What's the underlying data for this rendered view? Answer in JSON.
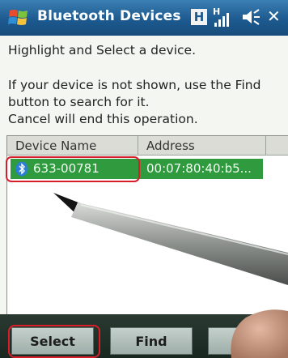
{
  "titlebar": {
    "title": "Bluetooth Devices",
    "status_h": "H",
    "icons": [
      "windows-start-icon",
      "signal-icon",
      "volume-icon",
      "close-icon"
    ]
  },
  "body": {
    "instruction": "Highlight and Select a device.",
    "note_lines": [
      "If your device is not shown, use the Find",
      "button to search for it.",
      "Cancel will end this operation."
    ]
  },
  "list": {
    "columns": [
      "Device Name",
      "Address"
    ],
    "rows": [
      {
        "icon": "bluetooth-icon",
        "name": "633-00781",
        "address": "00:07:80:40:b5..."
      }
    ],
    "selected_color": "#2f9a3e"
  },
  "buttons": {
    "select": "Select",
    "find": "Find"
  },
  "colors": {
    "titlebar": "#1d5a8f",
    "highlight_annotation": "#d91e2b"
  }
}
